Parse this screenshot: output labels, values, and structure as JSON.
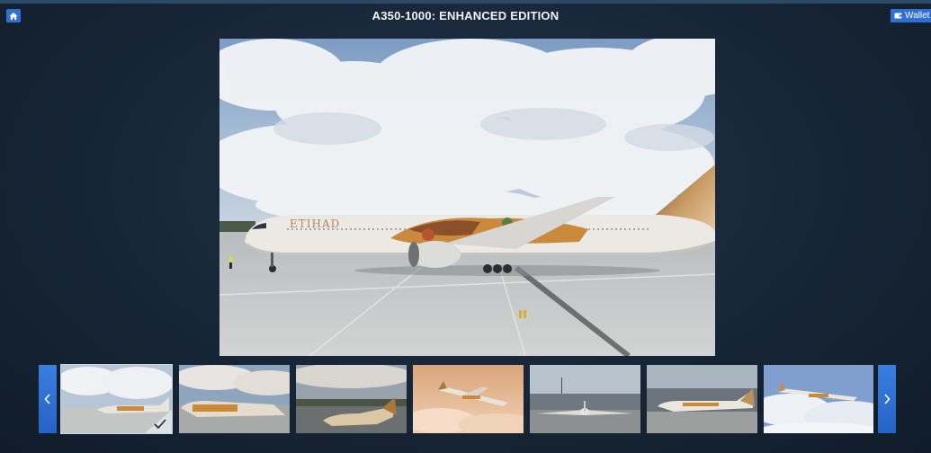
{
  "header": {
    "title": "A350-1000: ENHANCED EDITION",
    "home_icon": "home-icon",
    "wallet_label": "Wallet",
    "wallet_icon": "wallet-icon"
  },
  "gallery": {
    "selected_index": 0,
    "main_image": "airliner-on-apron-with-clouds",
    "livery_text": "ETIHAD",
    "thumbnails": [
      "side-view-apron",
      "side-view-apron-wide",
      "rear-quarter-apron",
      "airborne-above-clouds-sunset",
      "front-view-runway",
      "side-view-hangar",
      "airborne-above-clouds"
    ],
    "prev_icon": "chevron-left-icon",
    "next_icon": "chevron-right-icon"
  },
  "colors": {
    "accent": "#2f6fd2",
    "background": "#172637"
  }
}
